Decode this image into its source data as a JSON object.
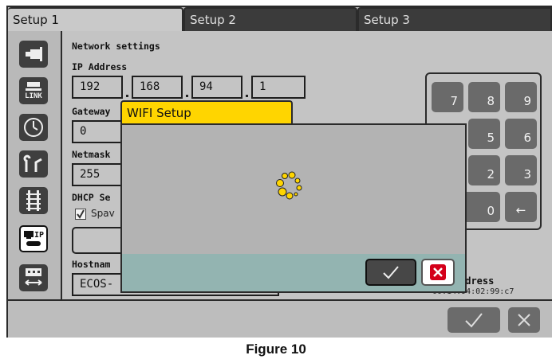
{
  "tabs": [
    {
      "label": "Setup 1",
      "active": true
    },
    {
      "label": "Setup 2",
      "active": false
    },
    {
      "label": "Setup 3",
      "active": false
    }
  ],
  "sidebar": {
    "items": [
      {
        "icon": "locomotive-icon",
        "label": ""
      },
      {
        "icon": "link-icon",
        "label": "LINK"
      },
      {
        "icon": "clock-icon",
        "label": ""
      },
      {
        "icon": "turnout-icon",
        "label": ""
      },
      {
        "icon": "track-icon",
        "label": ""
      },
      {
        "icon": "network-ip-icon",
        "label": "IP",
        "active": true
      },
      {
        "icon": "train-wagon-icon",
        "label": ""
      }
    ]
  },
  "network": {
    "section_title": "Network settings",
    "ip_label": "IP Address",
    "ip": [
      "192",
      "168",
      "94",
      "1"
    ],
    "gateway_label": "Gateway",
    "gateway_first": "0",
    "netmask_label": "Netmask",
    "netmask_first": "255",
    "dhcp_label": "DHCP Se",
    "dhcp_checkbox_label": "Spav",
    "hostname_label": "Hostnam",
    "hostname_value": "ECOS-",
    "mac_label": "ddress",
    "mac_value": "00:14:94:02:99:c7"
  },
  "keypad": {
    "keys": [
      "7",
      "8",
      "9",
      "5",
      "6",
      "2",
      "3",
      "0",
      "←"
    ]
  },
  "modal": {
    "title": "WIFI Setup",
    "spinner": "loading-spinner-icon",
    "ok_icon": "check-icon",
    "cancel_icon": "close-icon"
  },
  "bottom_bar": {
    "ok_icon": "check-icon",
    "cancel_icon": "close-icon"
  },
  "caption": "Figure 10",
  "colors": {
    "accent_yellow": "#ffd500",
    "modal_footer": "#93b4b1",
    "cancel_red": "#d4001a"
  }
}
